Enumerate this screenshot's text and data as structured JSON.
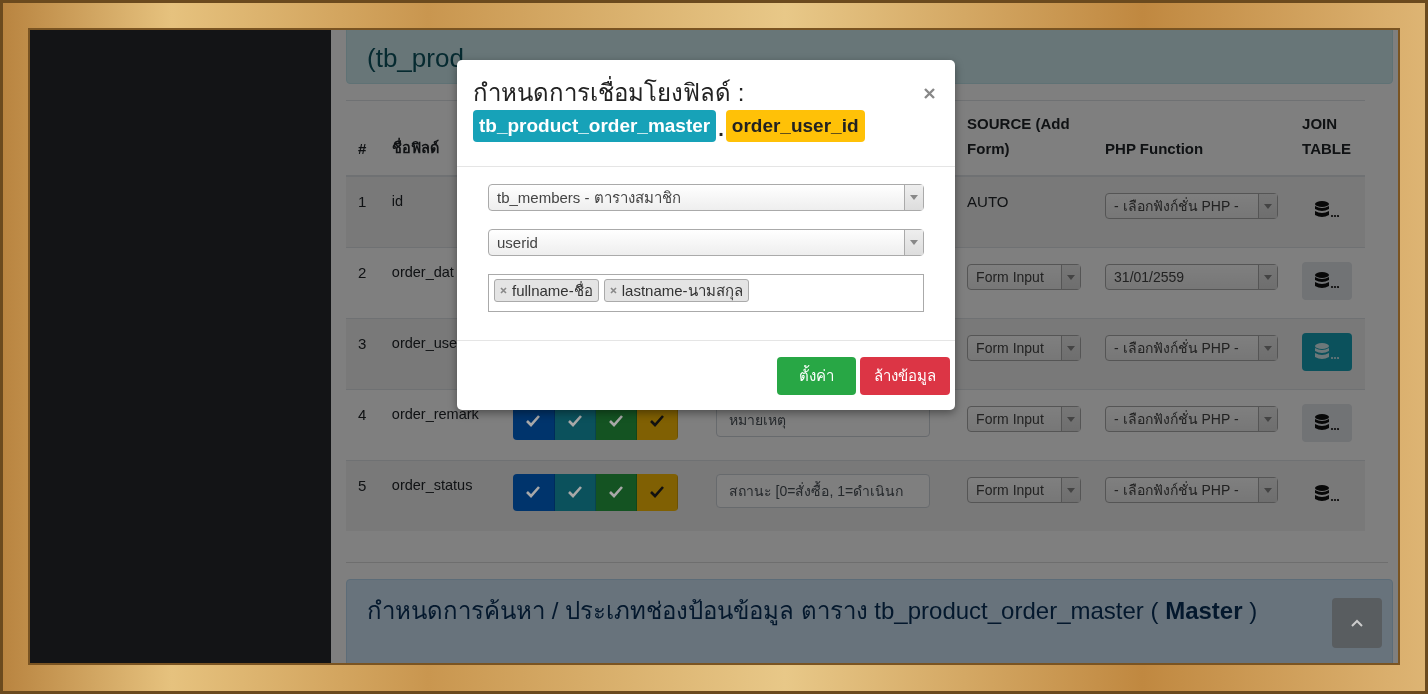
{
  "top_panel": {
    "title": "(tb_prod"
  },
  "table": {
    "columns": [
      "#",
      "ชื่อฟิลด์",
      null,
      null,
      "SOURCE (Add Form)",
      "PHP Function",
      "JOIN TABLE"
    ],
    "rows": [
      {
        "num": "1",
        "name": "id",
        "source": {
          "kind": "text",
          "value": "AUTO"
        },
        "php": "- เลือกฟังก์ชั่น PHP -",
        "join": {
          "kind": "plain",
          "selected": false
        }
      },
      {
        "num": "2",
        "name": "order_dat",
        "source": {
          "kind": "select",
          "value": "Form Input"
        },
        "php": "31/01/2559",
        "join": {
          "kind": "light",
          "selected": false
        }
      },
      {
        "num": "3",
        "name": "order_use",
        "source": {
          "kind": "select",
          "value": "Form Input"
        },
        "php": "- เลือกฟังก์ชั่น PHP -",
        "join": {
          "selected": true
        }
      },
      {
        "num": "4",
        "name": "order_remark",
        "toggles": [
          {
            "color": "#00346c",
            "checked": true
          },
          {
            "color": "#0b515c",
            "checked": true
          },
          {
            "color": "#145322",
            "checked": true
          },
          {
            "color": "#806003",
            "checked": true
          }
        ],
        "label_value": "หมายเหตุ",
        "source": {
          "kind": "select",
          "value": "Form Input"
        },
        "php": "- เลือกฟังก์ชั่น PHP -",
        "join": {
          "kind": "light",
          "selected": false
        }
      },
      {
        "num": "5",
        "name": "order_status",
        "toggles": [
          {
            "color": "#00346c",
            "checked": true
          },
          {
            "color": "#0b515c",
            "checked": true
          },
          {
            "color": "#145322",
            "checked": true
          },
          {
            "color": "#806003",
            "checked": true
          }
        ],
        "label_value": "สถานะ [0=สั่งซื้อ, 1=ดำเนินก",
        "source": {
          "kind": "select",
          "value": "Form Input"
        },
        "php": "- เลือกฟังก์ชั่น PHP -",
        "join": {
          "kind": "plain",
          "selected": false
        }
      }
    ]
  },
  "bottom_panel": {
    "title": "กำหนดการค้นหา / ประเภทช่องป้อนข้อมูล ตาราง tb_product_order_master ( **Master** )"
  },
  "modal": {
    "title": "กำหนดการเชื่อมโยงฟิลด์ :",
    "table_badge": "tb_product_order_master",
    "separator": ".",
    "field_badge": "order_user_id",
    "table_select": "tb_members - ตารางสมาชิก",
    "key_select": "userid",
    "display_fields": [
      "fullname-ชื่อ",
      "lastname-นามสกุล"
    ],
    "buttons": [
      {
        "kind": "success",
        "label": "ตั้งค่า"
      },
      {
        "kind": "danger",
        "label": "ล้างข้อมูล"
      }
    ]
  }
}
